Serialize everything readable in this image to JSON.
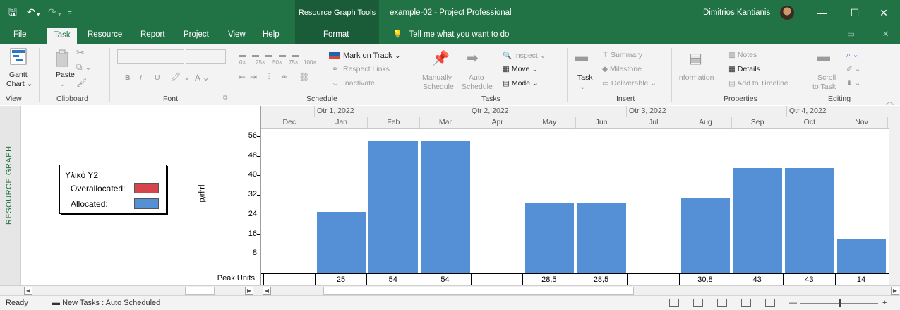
{
  "titlebar": {
    "context_tools": "Resource Graph Tools",
    "title": "example-02  -  Project Professional",
    "user": "Dimitrios Kantianis",
    "minimize": "—",
    "restore": "☐",
    "close": "✕",
    "save_icon": "save-icon",
    "undo_icon": "undo-icon"
  },
  "tabs": [
    "File",
    "Task",
    "Resource",
    "Report",
    "Project",
    "View",
    "Help"
  ],
  "active_tab": "Task",
  "context_tab": "Format",
  "tell_me": "Tell me what you want to do",
  "ribbon": {
    "view": {
      "gantt": "Gantt",
      "chart": "Chart",
      "group": "View"
    },
    "clipboard": {
      "paste": "Paste",
      "group": "Clipboard"
    },
    "font": {
      "bold": "B",
      "italic": "I",
      "underline": "U",
      "font_color": "A",
      "group": "Font"
    },
    "schedule": {
      "mark_on_track": "Mark on Track",
      "respect_links": "Respect Links",
      "inactivate": "Inactivate",
      "pct": [
        "0×",
        "25×",
        "50×",
        "75×",
        "100×"
      ],
      "group": "Schedule"
    },
    "tasks": {
      "manually": "Manually",
      "schedule1": "Schedule",
      "auto": "Auto",
      "schedule2": "Schedule",
      "inspect": "Inspect",
      "move": "Move",
      "mode": "Mode",
      "group": "Tasks"
    },
    "insert": {
      "task": "Task",
      "summary": "Summary",
      "milestone": "Milestone",
      "deliverable": "Deliverable",
      "group": "Insert"
    },
    "properties": {
      "information": "Information",
      "notes": "Notes",
      "details": "Details",
      "add_to_timeline": "Add to Timeline",
      "group": "Properties"
    },
    "editing": {
      "scroll": "Scroll",
      "to_task": "to Task",
      "group": "Editing"
    }
  },
  "left": {
    "vertical_label": "RESOURCE GRAPH",
    "legend": {
      "title": "Υλικό Υ2",
      "overallocated": "Overallocated:",
      "allocated": "Allocated:",
      "overallocated_color": "#d6454b",
      "allocated_color": "#5590d6"
    },
    "units": "μ.μ/d",
    "peak_units": "Peak Units:"
  },
  "timescale": {
    "quarters": [
      "Qtr 1, 2022",
      "Qtr 2, 2022",
      "Qtr 3, 2022",
      "Qtr 4, 2022"
    ],
    "months": [
      "Dec",
      "Jan",
      "Feb",
      "Mar",
      "Apr",
      "May",
      "Jun",
      "Jul",
      "Aug",
      "Sep",
      "Oct",
      "Nov"
    ]
  },
  "chart_data": {
    "type": "bar",
    "categories": [
      "Dec",
      "Jan",
      "Feb",
      "Mar",
      "Apr",
      "May",
      "Jun",
      "Jul",
      "Aug",
      "Sep",
      "Oct",
      "Nov"
    ],
    "values": [
      0,
      25,
      54,
      54,
      0,
      28.5,
      28.5,
      0,
      30.8,
      43,
      43,
      14
    ],
    "peak_labels": [
      "",
      "25",
      "54",
      "54",
      "",
      "28,5",
      "28,5",
      "",
      "30,8",
      "43",
      "43",
      "14"
    ],
    "yticks": [
      "8",
      "16",
      "24",
      "32",
      "40",
      "48",
      "56"
    ],
    "ylim": [
      0,
      58
    ],
    "color": "#5590d6"
  },
  "statusbar": {
    "ready": "Ready",
    "new_tasks": "New Tasks : Auto Scheduled",
    "zoom_minus": "—",
    "zoom_plus": "+"
  }
}
